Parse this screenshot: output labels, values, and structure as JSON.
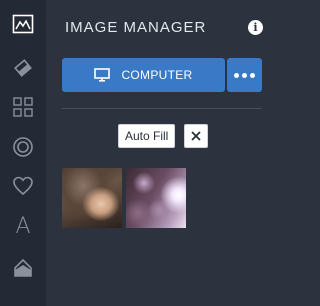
{
  "sidebar": {
    "items": [
      {
        "icon": "image-manager-icon",
        "active": true
      },
      {
        "icon": "eraser-icon",
        "active": false
      },
      {
        "icon": "grid-icon",
        "active": false
      },
      {
        "icon": "circle-icon",
        "active": false
      },
      {
        "icon": "heart-icon",
        "active": false
      },
      {
        "icon": "text-icon",
        "label": "A",
        "active": false
      },
      {
        "icon": "paint-bucket-icon",
        "active": false
      }
    ]
  },
  "panel": {
    "title": "IMAGE MANAGER",
    "info_icon": "i",
    "computer_button": {
      "label": "COMPUTER",
      "icon": "monitor-icon"
    },
    "more_button": {
      "icon": "more-dots-icon"
    },
    "auto_fill_label": "Auto Fill",
    "close_icon": "close-icon",
    "thumbnails": [
      "woman-hair-portrait",
      "bokeh-lights"
    ]
  },
  "colors": {
    "background": "#2c323e",
    "rail": "#242a35",
    "accent": "#3a79c6",
    "text": "#e3e7ee"
  }
}
